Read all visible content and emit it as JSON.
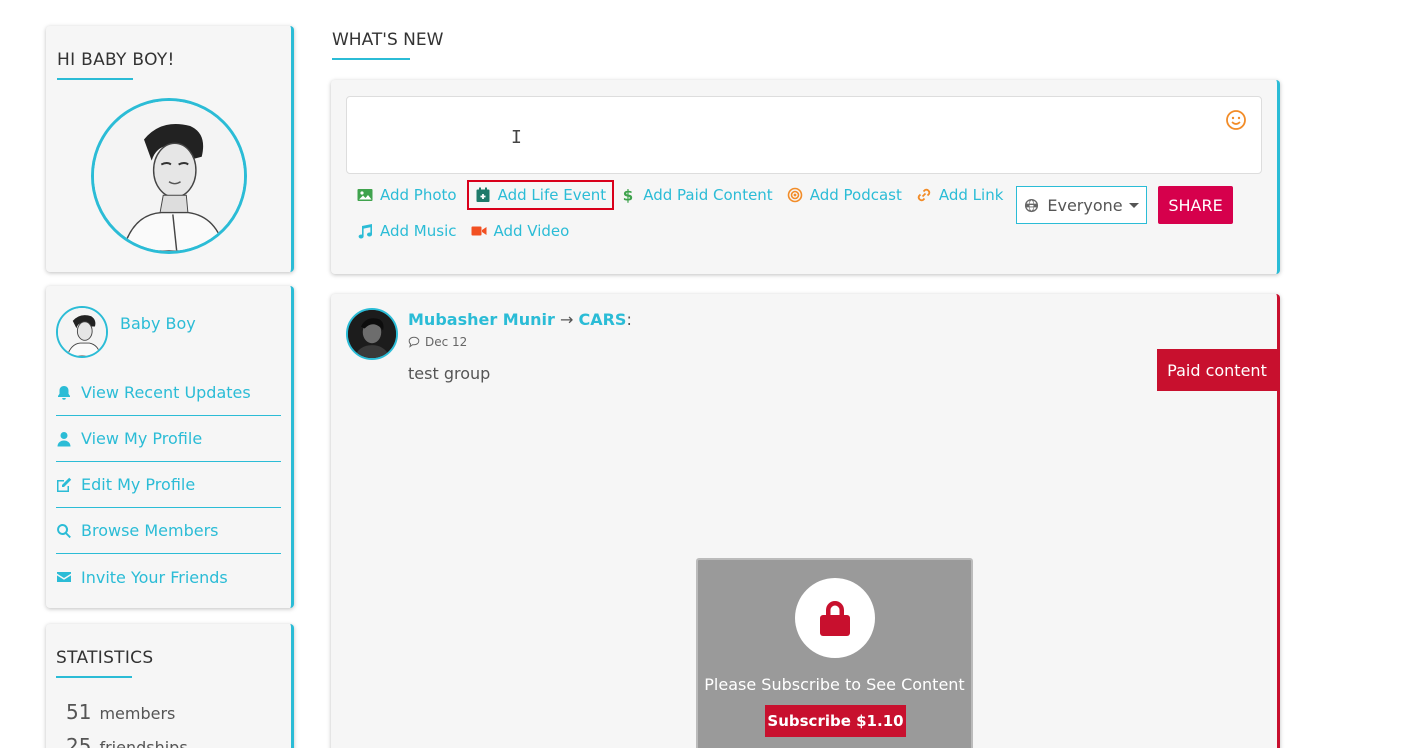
{
  "sidebar": {
    "greeting_title": "HI BABY BOY!",
    "user_name": "Baby Boy",
    "nav_items": [
      {
        "label": "View Recent Updates",
        "icon": "bell-icon"
      },
      {
        "label": "View My Profile",
        "icon": "user-icon"
      },
      {
        "label": "Edit My Profile",
        "icon": "edit-icon"
      },
      {
        "label": "Browse Members",
        "icon": "search-icon"
      },
      {
        "label": "Invite Your Friends",
        "icon": "envelope-icon"
      }
    ],
    "statistics": {
      "title": "STATISTICS",
      "items": [
        {
          "value": "51",
          "label": "members"
        },
        {
          "value": "25",
          "label": "friendships"
        }
      ]
    }
  },
  "whats_new": {
    "title": "WHAT'S NEW",
    "composer": {
      "text_cursor": "I",
      "actions": [
        {
          "label": "Add Photo",
          "icon": "image-icon",
          "color": "#3fa34d"
        },
        {
          "label": "Add Life Event",
          "icon": "calendar-icon",
          "color": "#1e7a6a"
        },
        {
          "label": "Add Paid Content",
          "icon": "dollar-icon",
          "color": "#3fa34d"
        },
        {
          "label": "Add Podcast",
          "icon": "podcast-icon",
          "color": "#f28c28"
        },
        {
          "label": "Add Link",
          "icon": "link-icon",
          "color": "#f28c28"
        },
        {
          "label": "Add Music",
          "icon": "music-icon",
          "color": "#2bbcd6"
        },
        {
          "label": "Add Video",
          "icon": "video-icon",
          "color": "#f25022"
        }
      ],
      "audience": "Everyone",
      "share_label": "SHARE"
    }
  },
  "post": {
    "author": "Mubasher Munir",
    "arrow": "→",
    "group": "CARS",
    "colon": ":",
    "date": "Dec 12",
    "text": "test group",
    "paid_badge": "Paid content",
    "lock_message": "Please Subscribe to See Content",
    "subscribe_label": "Subscribe $1.10"
  },
  "colors": {
    "accent": "#2bbcd6",
    "share": "#d6004c",
    "paid": "#c8102e"
  }
}
